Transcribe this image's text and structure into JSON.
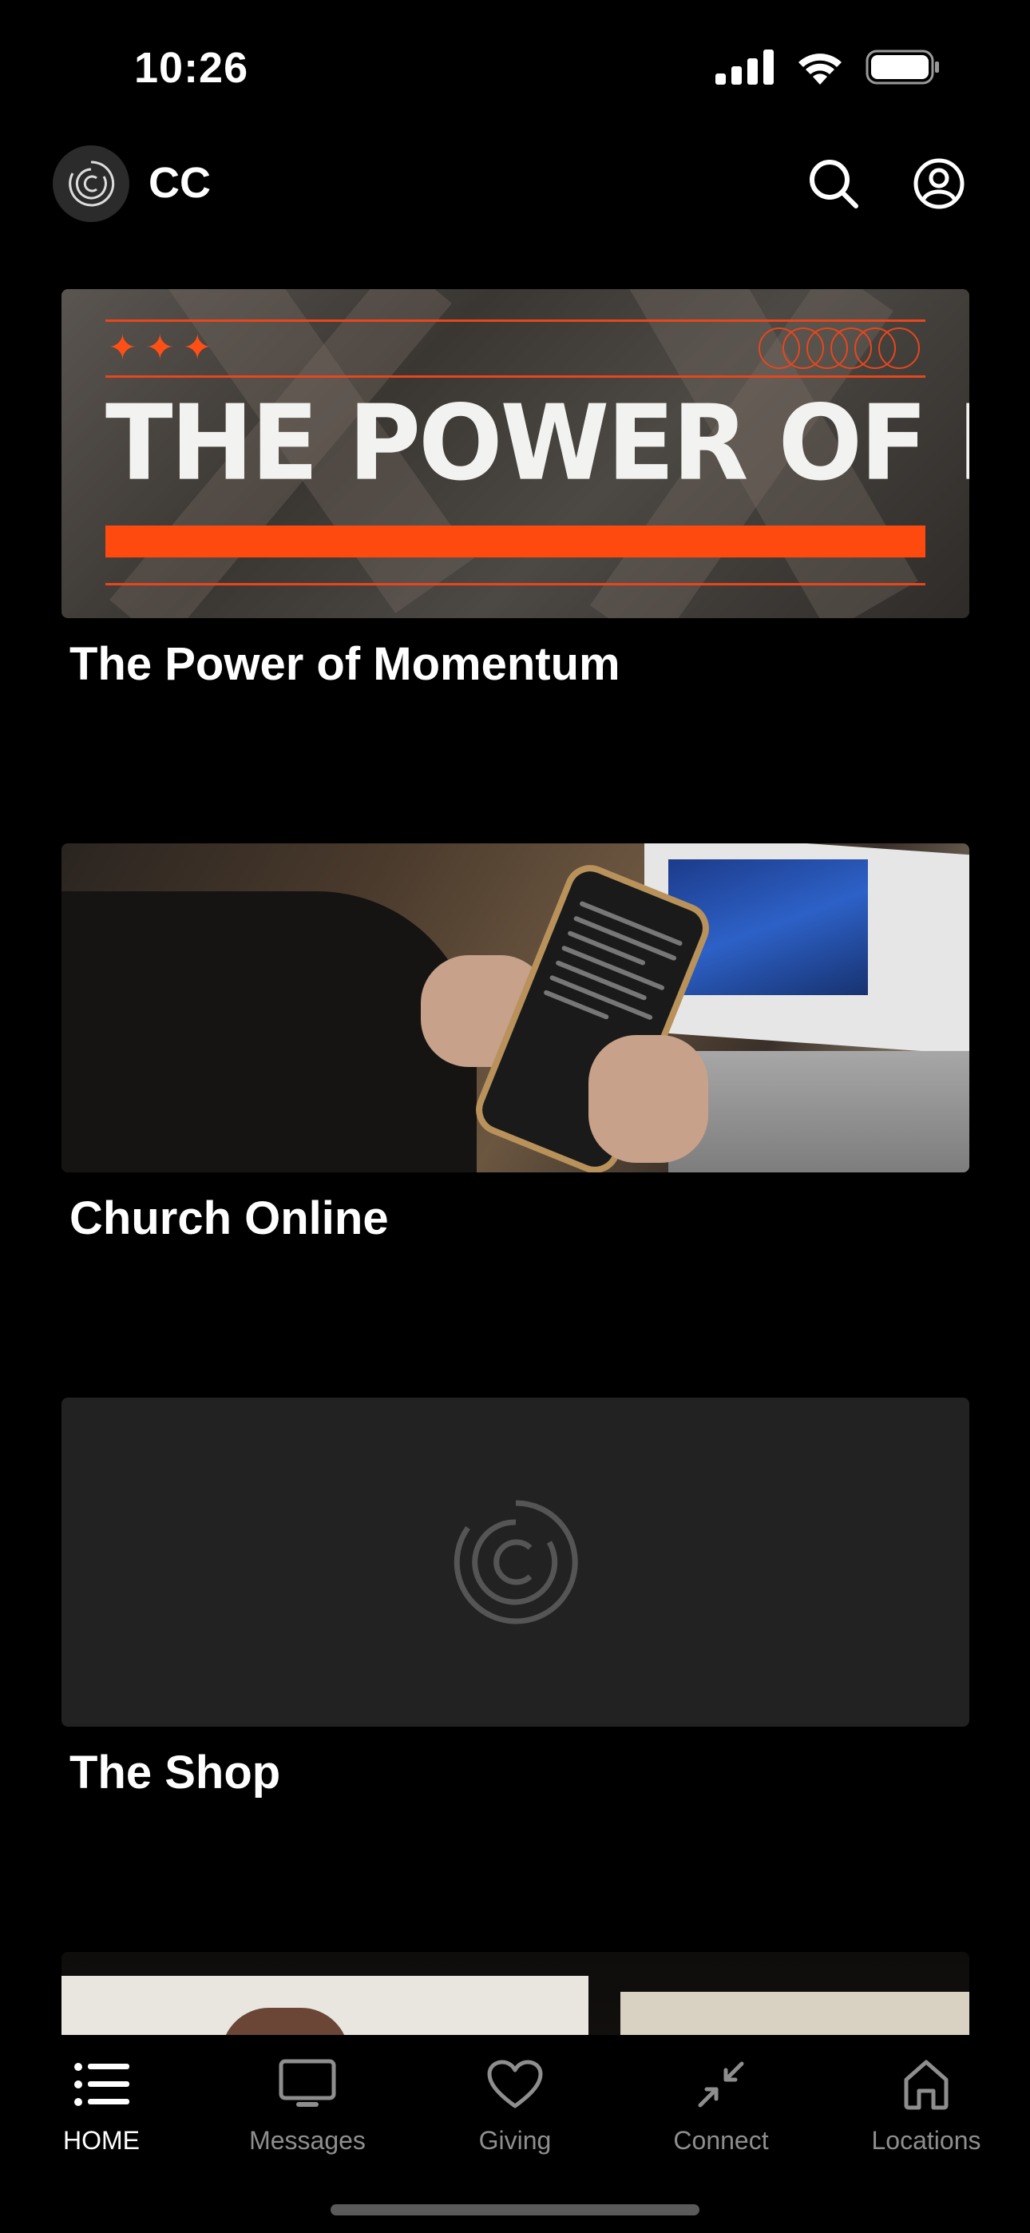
{
  "status_bar": {
    "time": "10:26"
  },
  "header": {
    "brand": "CC",
    "icons": [
      "logo-icon",
      "search-icon",
      "profile-icon"
    ]
  },
  "cards": [
    {
      "title": "The Power of Momentum",
      "banner_text": "THE POWER OF MOMENTUM",
      "banner_stars": "✦✦✦"
    },
    {
      "title": "Church Online"
    },
    {
      "title": "The Shop"
    }
  ],
  "tabs": [
    {
      "label": "HOME",
      "icon": "list-icon",
      "active": true
    },
    {
      "label": "Messages",
      "icon": "monitor-icon",
      "active": false
    },
    {
      "label": "Giving",
      "icon": "heart-icon",
      "active": false
    },
    {
      "label": "Connect",
      "icon": "arrows-inward-icon",
      "active": false
    },
    {
      "label": "Locations",
      "icon": "house-icon",
      "active": false
    }
  ],
  "colors": {
    "background": "#000000",
    "accent": "#ff4a0f",
    "tab_inactive": "#8e8e8e",
    "placeholder": "#222222"
  }
}
